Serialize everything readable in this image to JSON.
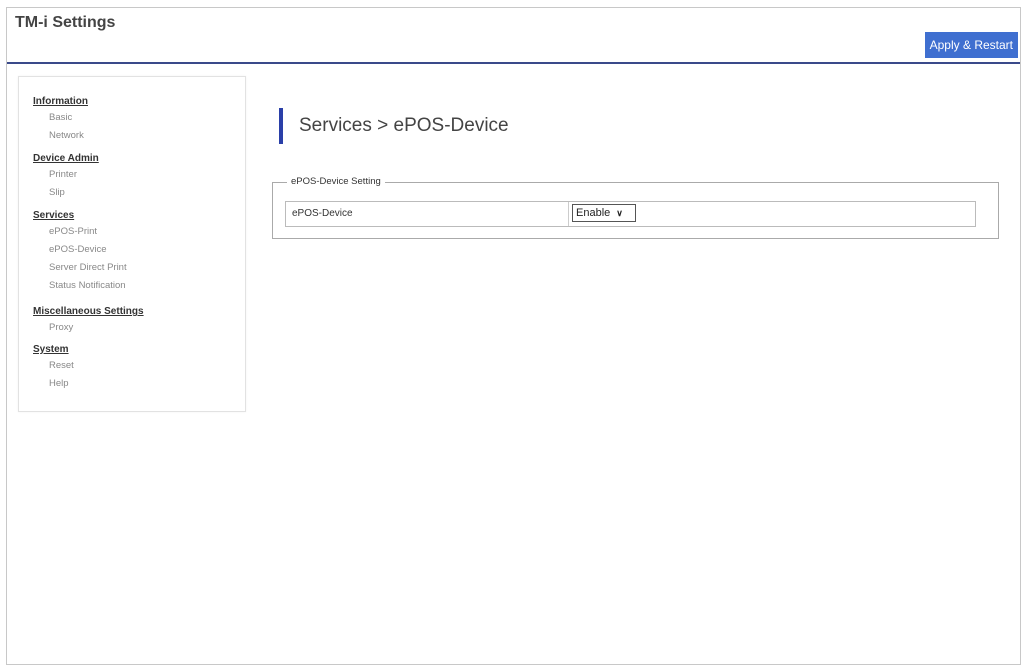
{
  "header": {
    "title": "TM-i Settings",
    "apply_label": "Apply & Restart"
  },
  "sidebar": {
    "sections": [
      {
        "label": "Information",
        "items": [
          "Basic",
          "Network"
        ]
      },
      {
        "label": "Device Admin",
        "items": [
          "Printer",
          "Slip"
        ]
      },
      {
        "label": "Services",
        "items": [
          "ePOS-Print",
          "ePOS-Device",
          "Server Direct Print",
          "Status Notification"
        ]
      },
      {
        "label": "Miscellaneous Settings",
        "items": [
          "Proxy"
        ]
      },
      {
        "label": "System",
        "items": [
          "Reset",
          "Help"
        ]
      }
    ]
  },
  "main": {
    "heading": "Services > ePOS-Device",
    "fieldset_legend": "ePOS-Device Setting",
    "setting_label": "ePOS-Device",
    "setting_value": "Enable"
  },
  "colors": {
    "accent": "#2a3fa8",
    "button": "#3f6fd0",
    "header_rule": "#3a4a8a"
  }
}
